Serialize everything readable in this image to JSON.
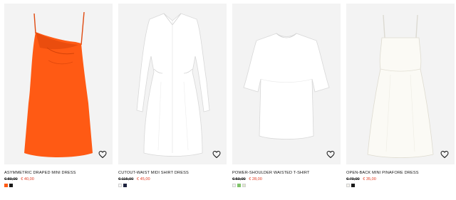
{
  "products": [
    {
      "name": "ASYMMETRIC DRAPED MINI DRESS",
      "old_price": "€ 89,00",
      "new_price": "€ 40,00",
      "swatches": [
        "#ff5a14",
        "#1a1a1a"
      ]
    },
    {
      "name": "CUTOUT-WAIST MIDI SHIRT DRESS",
      "old_price": "€ 115,00",
      "new_price": "€ 45,00",
      "swatches": [
        "#f7f7f7",
        "#1f2440"
      ]
    },
    {
      "name": "POWER-SHOULDER WAISTED T-SHIRT",
      "old_price": "€ 59,00",
      "new_price": "€ 28,00",
      "swatches": [
        "#f2f2f2",
        "#7fc36a",
        "#dfe9cc"
      ]
    },
    {
      "name": "OPEN-BACK MINI PINAFORE DRESS",
      "old_price": "€ 79,00",
      "new_price": "€ 35,00",
      "swatches": [
        "#f5f3ec",
        "#1a1a1a"
      ]
    }
  ],
  "colors": {
    "background": "#ffffff",
    "image_bg": "#f3f3f3",
    "sale_price": "#e2391f",
    "text": "#111111"
  },
  "icons": {
    "favorite": "heart-icon"
  }
}
